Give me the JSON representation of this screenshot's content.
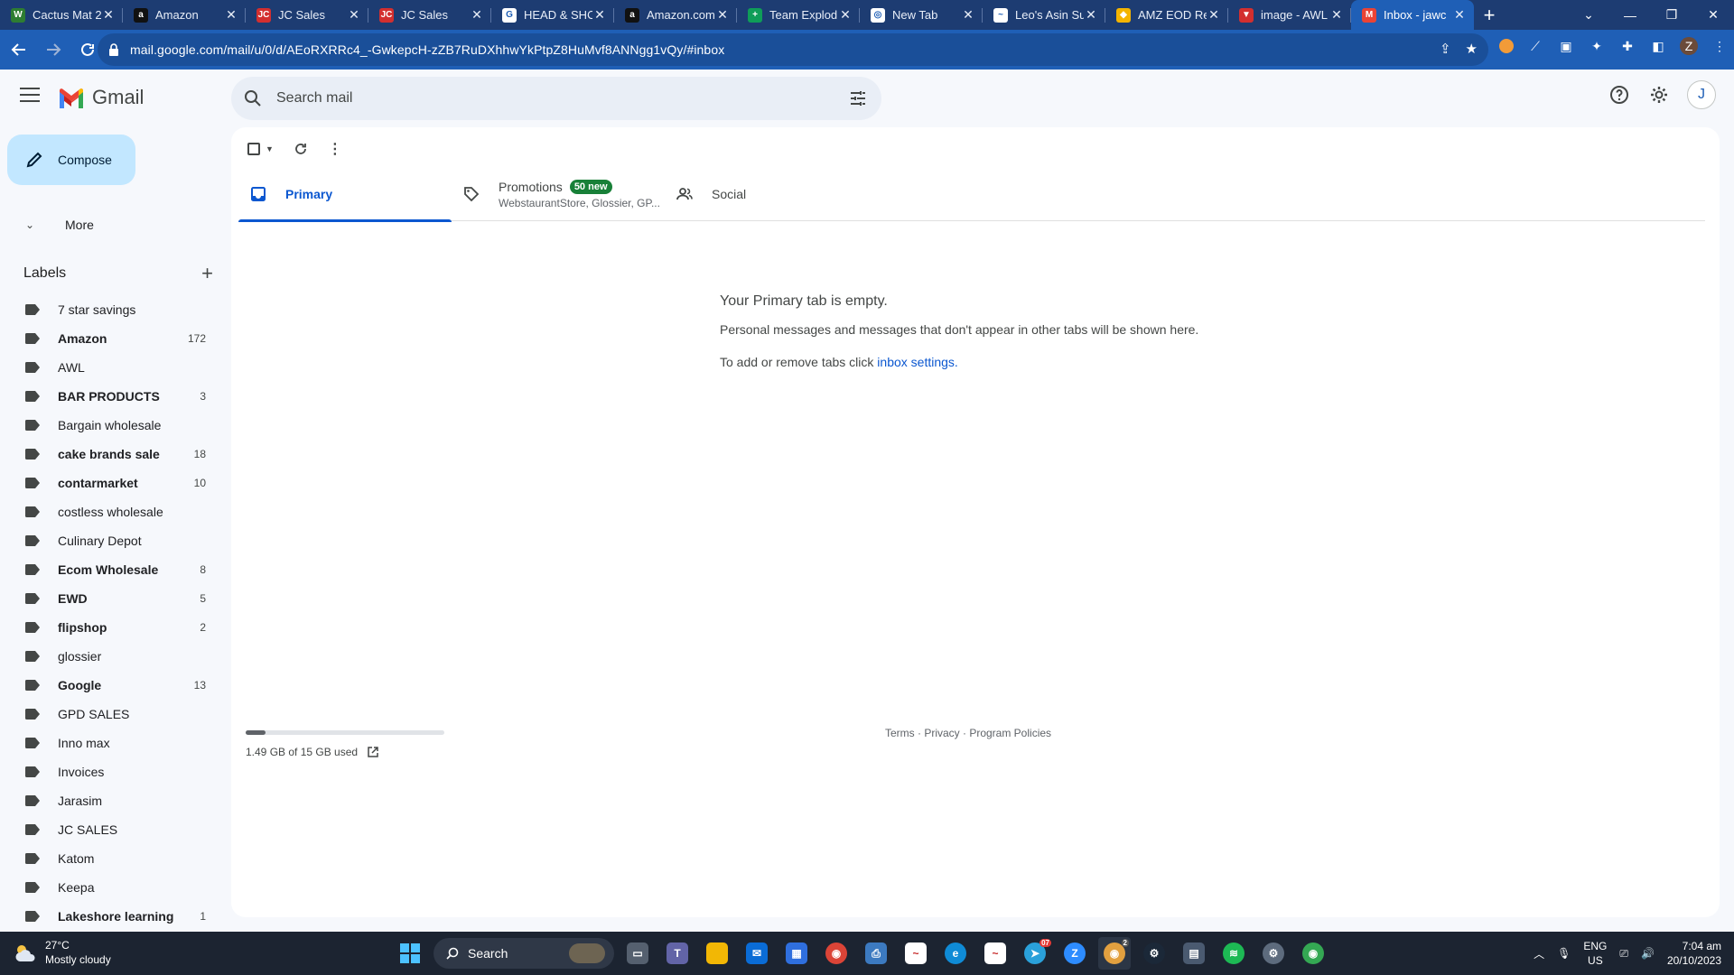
{
  "browser": {
    "tabs": [
      {
        "title": "Cactus Mat 2",
        "icon": "w-icon",
        "color": "#2e7d32",
        "glyph": "W"
      },
      {
        "title": "Amazon",
        "icon": "amazon-icon",
        "color": "#111111",
        "glyph": "a"
      },
      {
        "title": "JC Sales",
        "icon": "jc-sales-icon",
        "color": "#d32f2f",
        "glyph": "JC"
      },
      {
        "title": "JC Sales",
        "icon": "jc-sales-icon",
        "color": "#d32f2f",
        "glyph": "JC"
      },
      {
        "title": "HEAD & SHO",
        "icon": "google-icon",
        "color": "#ffffff",
        "glyph": "G"
      },
      {
        "title": "Amazon.com",
        "icon": "amazon-icon",
        "color": "#111111",
        "glyph": "a"
      },
      {
        "title": "Team Explod",
        "icon": "sheets-icon",
        "color": "#0f9d58",
        "glyph": "+"
      },
      {
        "title": "New Tab",
        "icon": "chrome-icon",
        "color": "#ffffff",
        "glyph": "◎"
      },
      {
        "title": "Leo's Asin Su",
        "icon": "chart-icon",
        "color": "#ffffff",
        "glyph": "~"
      },
      {
        "title": "AMZ EOD Re",
        "icon": "multicolor-icon",
        "color": "#f4b400",
        "glyph": "◆"
      },
      {
        "title": "image - AWL",
        "icon": "image-icon",
        "color": "#d32f2f",
        "glyph": "▼"
      },
      {
        "title": "Inbox - jawc",
        "icon": "gmail-icon",
        "color": "#ea4335",
        "glyph": "M"
      }
    ],
    "url": "mail.google.com/mail/u/0/d/AEoRXRRc4_-GwkepcH-zZB7RuDXhhwYkPtpZ8HuMvf8ANNgg1vQy/#inbox",
    "profile_initial": "Z"
  },
  "gmail": {
    "product": "Gmail",
    "search_placeholder": "Search mail",
    "account_initial": "J",
    "compose_label": "Compose",
    "more_label": "More",
    "labels_heading": "Labels",
    "labels": [
      {
        "name": "7 star savings",
        "count": "",
        "bold": false
      },
      {
        "name": "Amazon",
        "count": "172",
        "bold": true
      },
      {
        "name": "AWL",
        "count": "",
        "bold": false
      },
      {
        "name": "BAR PRODUCTS",
        "count": "3",
        "bold": true
      },
      {
        "name": "Bargain wholesale",
        "count": "",
        "bold": false
      },
      {
        "name": "cake brands sale",
        "count": "18",
        "bold": true
      },
      {
        "name": "contarmarket",
        "count": "10",
        "bold": true
      },
      {
        "name": "costless wholesale",
        "count": "",
        "bold": false
      },
      {
        "name": "Culinary Depot",
        "count": "",
        "bold": false
      },
      {
        "name": "Ecom Wholesale",
        "count": "8",
        "bold": true
      },
      {
        "name": "EWD",
        "count": "5",
        "bold": true
      },
      {
        "name": "flipshop",
        "count": "2",
        "bold": true
      },
      {
        "name": "glossier",
        "count": "",
        "bold": false
      },
      {
        "name": "Google",
        "count": "13",
        "bold": true
      },
      {
        "name": "GPD SALES",
        "count": "",
        "bold": false
      },
      {
        "name": "Inno max",
        "count": "",
        "bold": false
      },
      {
        "name": "Invoices",
        "count": "",
        "bold": false
      },
      {
        "name": "Jarasim",
        "count": "",
        "bold": false
      },
      {
        "name": "JC SALES",
        "count": "",
        "bold": false
      },
      {
        "name": "Katom",
        "count": "",
        "bold": false
      },
      {
        "name": "Keepa",
        "count": "",
        "bold": false
      },
      {
        "name": "Lakeshore learning",
        "count": "1",
        "bold": true
      }
    ],
    "tabs": {
      "primary": "Primary",
      "promotions": "Promotions",
      "promotions_badge": "50 new",
      "promotions_senders": "WebstaurantStore, Glossier, GP...",
      "social": "Social"
    },
    "empty": {
      "heading": "Your Primary tab is empty.",
      "line1": "Personal messages and messages that don't appear in other tabs will be shown here.",
      "line2_prefix": "To add or remove tabs click ",
      "line2_link": "inbox settings",
      "line2_suffix": "."
    },
    "storage": {
      "text": "1.49 GB of 15 GB used",
      "fraction": 0.099
    },
    "footer": "Terms · Privacy · Program Policies",
    "colors": {
      "accent": "#0b57d0",
      "compose_bg": "#c2e7ff",
      "badge": "#188038"
    }
  },
  "taskbar": {
    "temperature": "27°C",
    "weather": "Mostly cloudy",
    "search_label": "Search",
    "language": "ENG",
    "region": "US",
    "time": "7:04 am",
    "date": "20/10/2023",
    "telegram_badge": "07",
    "chrome_badge": "2"
  }
}
